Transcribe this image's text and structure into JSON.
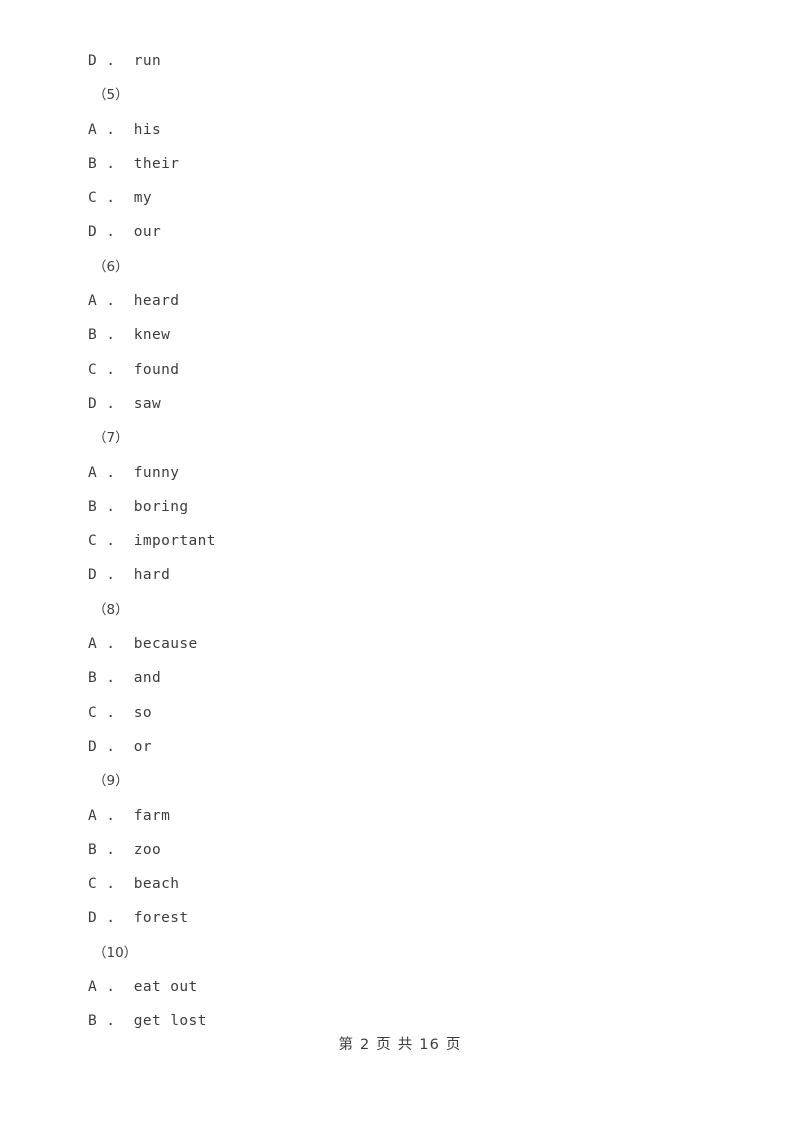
{
  "document": {
    "page_label": "第 2 页 共 16 页",
    "background_color": "#ffffff",
    "text_color": "#3d3d3d"
  },
  "body_lines": [
    {
      "kind": "option",
      "letter": "D",
      "separator": ".",
      "text": "run"
    },
    {
      "kind": "question",
      "number": "（5）"
    },
    {
      "kind": "option",
      "letter": "A",
      "separator": ".",
      "text": "his"
    },
    {
      "kind": "option",
      "letter": "B",
      "separator": ".",
      "text": "their"
    },
    {
      "kind": "option",
      "letter": "C",
      "separator": ".",
      "text": "my"
    },
    {
      "kind": "option",
      "letter": "D",
      "separator": ".",
      "text": "our"
    },
    {
      "kind": "question",
      "number": "（6）"
    },
    {
      "kind": "option",
      "letter": "A",
      "separator": ".",
      "text": "heard"
    },
    {
      "kind": "option",
      "letter": "B",
      "separator": ".",
      "text": "knew"
    },
    {
      "kind": "option",
      "letter": "C",
      "separator": ".",
      "text": "found"
    },
    {
      "kind": "option",
      "letter": "D",
      "separator": ".",
      "text": "saw"
    },
    {
      "kind": "question",
      "number": "（7）"
    },
    {
      "kind": "option",
      "letter": "A",
      "separator": ".",
      "text": "funny"
    },
    {
      "kind": "option",
      "letter": "B",
      "separator": ".",
      "text": "boring"
    },
    {
      "kind": "option",
      "letter": "C",
      "separator": ".",
      "text": "important"
    },
    {
      "kind": "option",
      "letter": "D",
      "separator": ".",
      "text": "hard"
    },
    {
      "kind": "question",
      "number": "（8）"
    },
    {
      "kind": "option",
      "letter": "A",
      "separator": ".",
      "text": "because"
    },
    {
      "kind": "option",
      "letter": "B",
      "separator": ".",
      "text": "and"
    },
    {
      "kind": "option",
      "letter": "C",
      "separator": ".",
      "text": "so"
    },
    {
      "kind": "option",
      "letter": "D",
      "separator": ".",
      "text": "or"
    },
    {
      "kind": "question",
      "number": "（9）"
    },
    {
      "kind": "option",
      "letter": "A",
      "separator": ".",
      "text": "farm"
    },
    {
      "kind": "option",
      "letter": "B",
      "separator": ".",
      "text": "zoo"
    },
    {
      "kind": "option",
      "letter": "C",
      "separator": ".",
      "text": "beach"
    },
    {
      "kind": "option",
      "letter": "D",
      "separator": ".",
      "text": "forest"
    },
    {
      "kind": "question",
      "number": "（10）"
    },
    {
      "kind": "option",
      "letter": "A",
      "separator": ".",
      "text": "eat out"
    },
    {
      "kind": "option",
      "letter": "B",
      "separator": ".",
      "text": "get lost"
    }
  ]
}
